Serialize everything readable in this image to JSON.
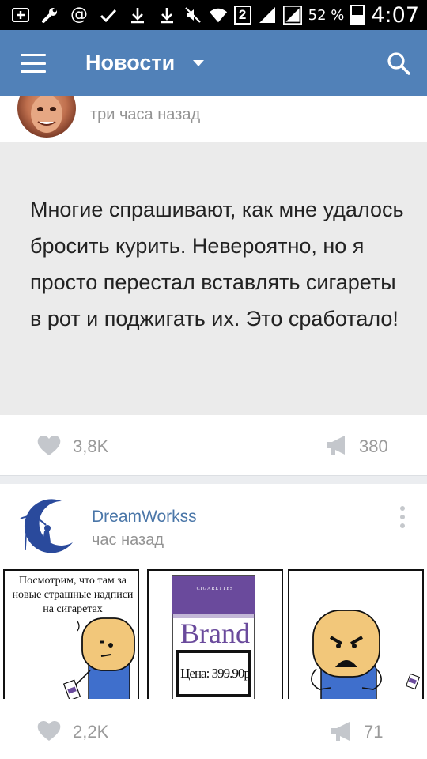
{
  "status_bar": {
    "battery_percent": "52 %",
    "battery_level": 0.52,
    "sim_slot": "2",
    "time": "4:07",
    "icons": [
      "plus-box-icon",
      "wrench-icon",
      "at-sign-icon",
      "check-icon",
      "download-icon",
      "download-icon",
      "mute-icon",
      "wifi-icon",
      "signal-icon",
      "signal-icon",
      "battery-icon"
    ]
  },
  "app_bar": {
    "title": "Новости",
    "menu_icon": "hamburger-icon",
    "search_icon": "search-icon"
  },
  "post1": {
    "time": "три часа назад",
    "text": "Многие спрашивают, как мне удалось бросить курить. Невероятно, но я просто перестал вставлять сигареты в рот и поджигать их. Это сработало!",
    "likes": "3,8K",
    "reposts": "380"
  },
  "post2": {
    "author": "DreamWorkss",
    "time": "час назад",
    "comic": {
      "panel1_caption": "Посмотрим, что там за новые страшные надписи на сигаретах",
      "panel2_band": "CIGARETTES",
      "panel2_brand": "Brand",
      "panel2_price": "Цена: 399.90р"
    },
    "likes": "2,2K",
    "reposts": "71"
  },
  "colors": {
    "header_blue": "#5181b8",
    "author_blue": "#4a76a8",
    "meta_gray": "#939393",
    "pack_purple": "#6a4a9c"
  }
}
